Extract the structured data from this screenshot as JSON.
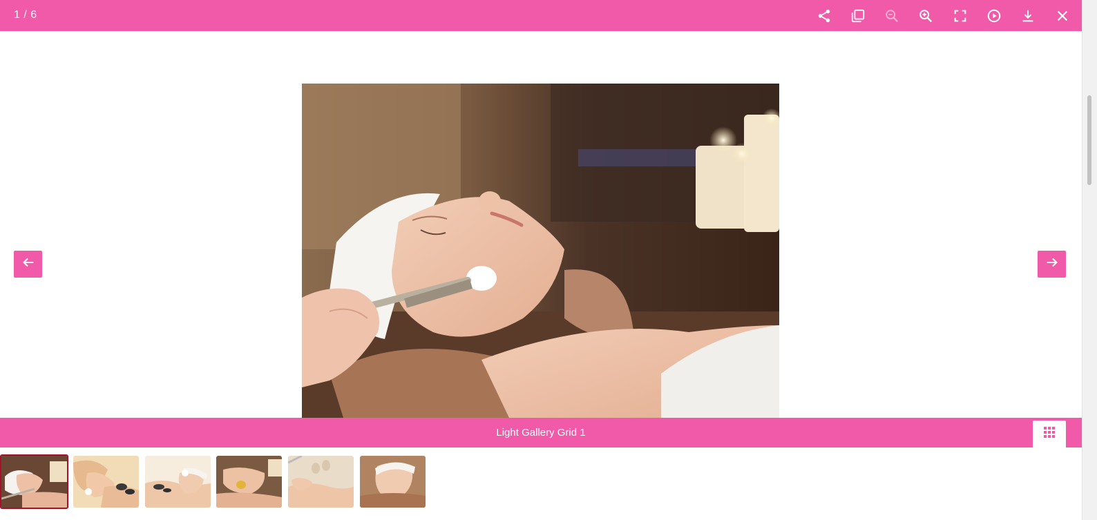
{
  "toolbar": {
    "counter": "1 / 6",
    "icons": [
      "share-icon",
      "copy-icon",
      "zoom-out-icon",
      "zoom-in-icon",
      "fullscreen-icon",
      "play-icon",
      "download-icon",
      "close-icon"
    ],
    "accent_color": "#f05aa8"
  },
  "viewer": {
    "current_index": 1,
    "total": 6,
    "prev_icon": "arrow-left-icon",
    "next_icon": "arrow-right-icon"
  },
  "caption": {
    "text": "Light Gallery Grid 1",
    "grid_icon": "grid-icon"
  },
  "thumbnails": {
    "count": 6,
    "active_index": 0,
    "active_border_color": "#a3122a"
  }
}
